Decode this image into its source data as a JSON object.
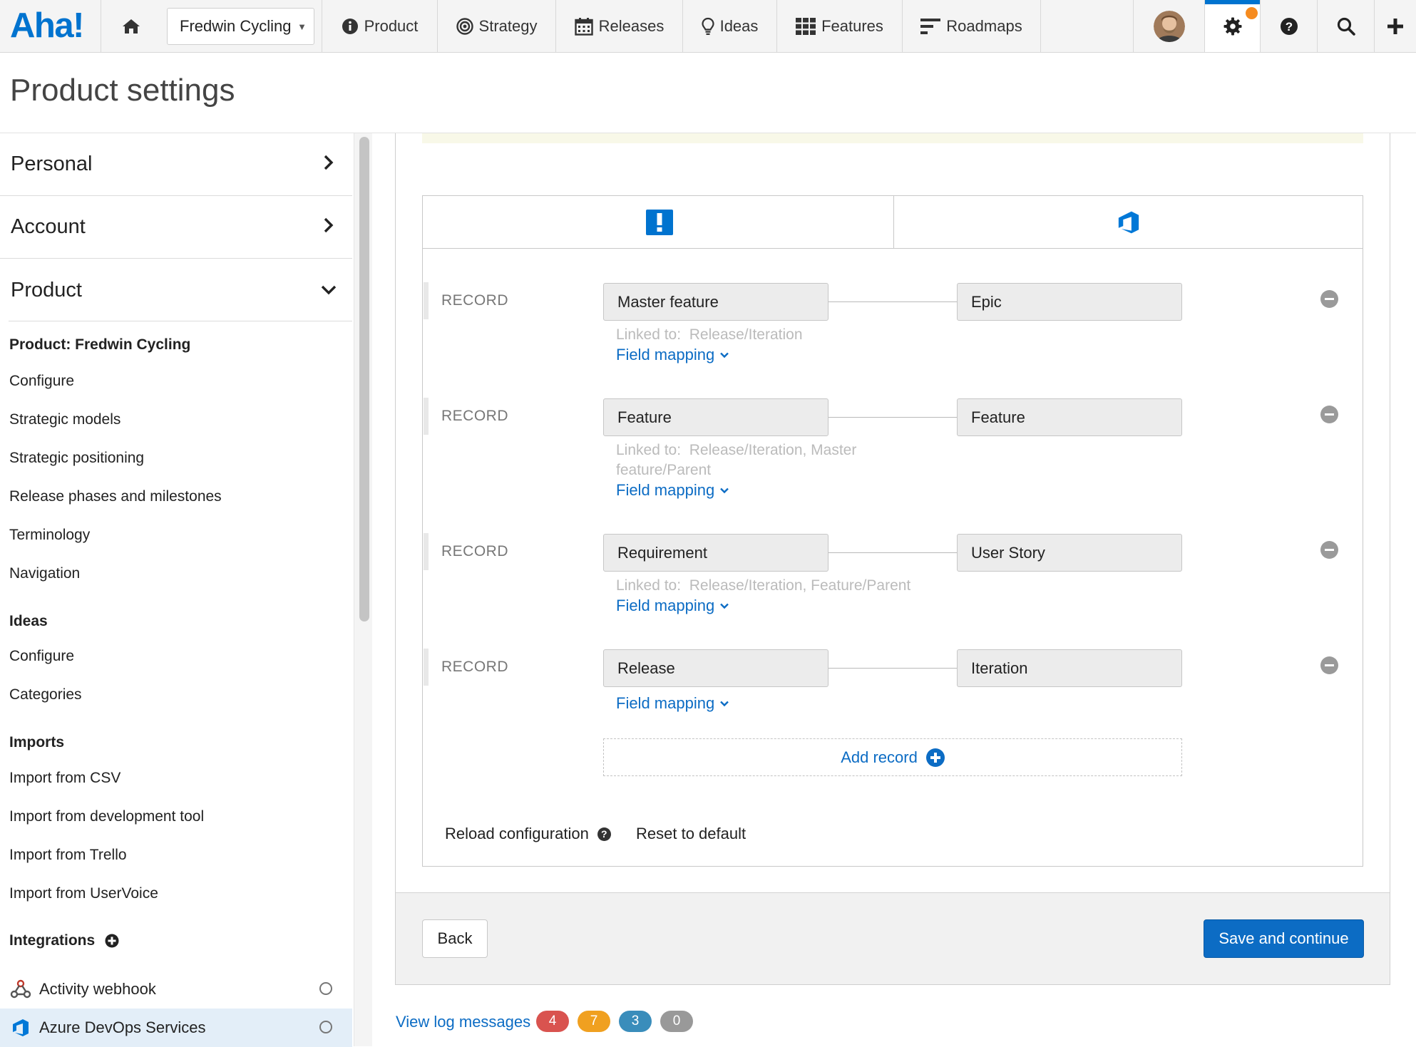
{
  "nav": {
    "logo": "Aha!",
    "product_select": "Fredwin Cycling",
    "items": [
      {
        "label": "Product",
        "icon": "info-circle-icon"
      },
      {
        "label": "Strategy",
        "icon": "target-icon"
      },
      {
        "label": "Releases",
        "icon": "calendar-icon"
      },
      {
        "label": "Ideas",
        "icon": "lightbulb-icon"
      },
      {
        "label": "Features",
        "icon": "grid-icon"
      },
      {
        "label": "Roadmaps",
        "icon": "roadmap-bars-icon"
      }
    ],
    "accent_color": "#0073cf",
    "notification_color": "#f68b1f"
  },
  "page": {
    "title": "Product settings"
  },
  "sidebar": {
    "accordions": [
      {
        "label": "Personal",
        "state": "collapsed"
      },
      {
        "label": "Account",
        "state": "collapsed"
      },
      {
        "label": "Product",
        "state": "expanded"
      }
    ],
    "product_header": "Product: Fredwin Cycling",
    "product_items": [
      "Configure",
      "Strategic models",
      "Strategic positioning",
      "Release phases and milestones",
      "Terminology",
      "Navigation"
    ],
    "ideas_header": "Ideas",
    "ideas_items": [
      "Configure",
      "Categories"
    ],
    "imports_header": "Imports",
    "imports_items": [
      "Import from CSV",
      "Import from development tool",
      "Import from Trello",
      "Import from UserVoice"
    ],
    "integrations_header": "Integrations",
    "integrations": [
      {
        "label": "Activity webhook",
        "icon": "webhook-icon",
        "active": false
      },
      {
        "label": "Azure DevOps Services",
        "icon": "azure-devops-icon",
        "active": true
      }
    ]
  },
  "mapping": {
    "left_header_icon": "aha-logo-icon",
    "right_header_icon": "azure-devops-icon",
    "records": [
      {
        "label": "RECORD",
        "aha": "Master feature",
        "ado": "Epic",
        "linked_prefix": "Linked to:",
        "linked": "Release/Iteration",
        "field_mapping": "Field mapping"
      },
      {
        "label": "RECORD",
        "aha": "Feature",
        "ado": "Feature",
        "linked_prefix": "Linked to:",
        "linked": "Release/Iteration, Master feature/Parent",
        "field_mapping": "Field mapping"
      },
      {
        "label": "RECORD",
        "aha": "Requirement",
        "ado": "User Story",
        "linked_prefix": "Linked to:",
        "linked": "Release/Iteration, Feature/Parent",
        "field_mapping": "Field mapping"
      },
      {
        "label": "RECORD",
        "aha": "Release",
        "ado": "Iteration",
        "linked_prefix": "",
        "linked": "",
        "field_mapping": "Field mapping"
      }
    ],
    "add_record": "Add record",
    "reload": "Reload configuration",
    "reset": "Reset to default"
  },
  "footer": {
    "back": "Back",
    "save": "Save and continue"
  },
  "log": {
    "link": "View log messages",
    "badges": [
      {
        "count": "4",
        "color": "#d9534f"
      },
      {
        "count": "7",
        "color": "#f0a020"
      },
      {
        "count": "3",
        "color": "#3a8dbb"
      },
      {
        "count": "0",
        "color": "#999999"
      }
    ]
  }
}
